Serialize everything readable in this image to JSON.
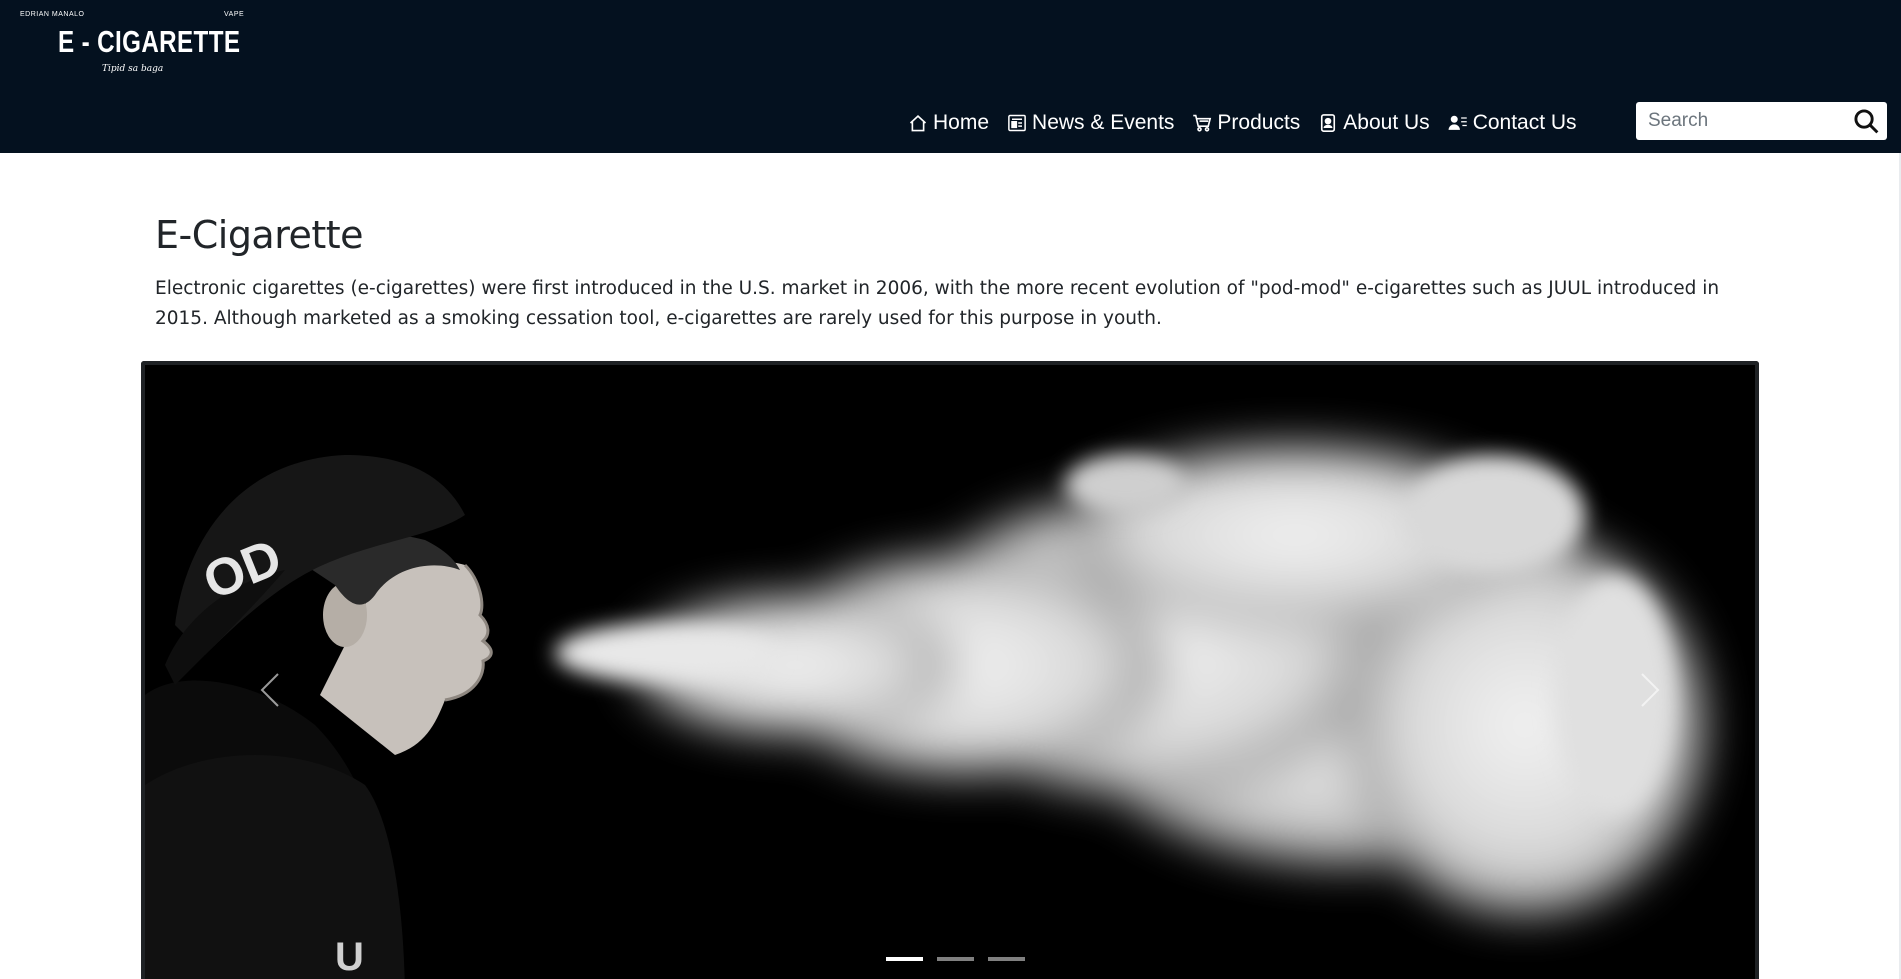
{
  "logo": {
    "top_left": "EDRIAN MANALO",
    "top_right": "VAPE",
    "brand": "E - CIGARETTE",
    "tagline": "Tipid sa baga"
  },
  "nav": {
    "items": [
      {
        "label": "Home",
        "icon": "home-icon"
      },
      {
        "label": "News & Events",
        "icon": "newspaper-icon"
      },
      {
        "label": "Products",
        "icon": "cart-icon"
      },
      {
        "label": "About Us",
        "icon": "person-badge-icon"
      },
      {
        "label": "Contact Us",
        "icon": "person-lines-icon"
      }
    ]
  },
  "search": {
    "placeholder": "Search",
    "value": ""
  },
  "main": {
    "title": "E-Cigarette",
    "intro": "Electronic cigarettes (e-cigarettes) were first introduced in the U.S. market in 2006, with the more recent evolution of \"pod-mod\" e-cigarettes such as JUUL introduced in 2015. Although marketed as a smoking cessation tool, e-cigarettes are rarely used for this purpose in youth."
  },
  "carousel": {
    "slide_count": 3,
    "active_index": 0,
    "cap_text": "OD"
  },
  "colors": {
    "header_bg": "#04111f",
    "text": "#212529"
  }
}
